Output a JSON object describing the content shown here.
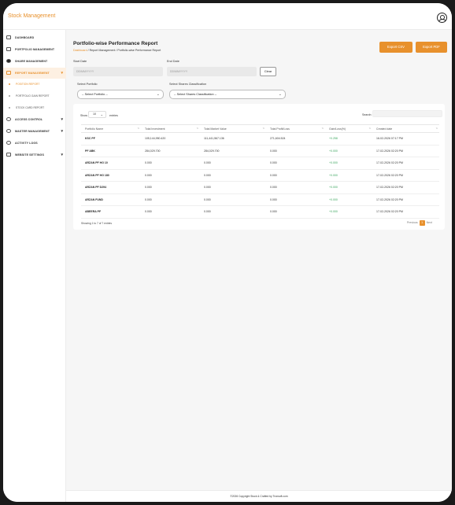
{
  "app": {
    "brand": "Stock Management"
  },
  "sidebar": {
    "items": [
      {
        "label": "DASHBOARD"
      },
      {
        "label": "PORTFOLIO MANAGEMENT"
      },
      {
        "label": "SHARE MANAGEMENT"
      },
      {
        "label": "REPORT MANAGEMENT",
        "expanded": true
      },
      {
        "label": "ACCESS CONTROL"
      },
      {
        "label": "MASTER MANAGEMENT"
      },
      {
        "label": "ACTIVITY LOGS"
      },
      {
        "label": "WEBSITE SETTINGS"
      }
    ],
    "report_sub": [
      {
        "label": "POSITION REPORT",
        "active": true
      },
      {
        "label": "PORTFOLIO GAIN REPORT"
      },
      {
        "label": "STOCK CARD REPORT"
      }
    ]
  },
  "page": {
    "title": "Portfolio-wise Performance Report",
    "breadcrumb_home": "Dashboard",
    "breadcrumb_rest": " / Report Management / Portfolio-wise Performance Report",
    "export_csv": "Export CSV",
    "export_pdf": "Export PDF"
  },
  "filters": {
    "start_label": "Start Date",
    "start_placeholder": "DD/MM/YYYY",
    "end_label": "End Date",
    "end_placeholder": "DD/MM/YYYY",
    "clear": "Clear",
    "portfolio_label": "Select Portfolio",
    "portfolio_value": "-- Select Portfolio --",
    "class_label": "Select Shares Classification",
    "class_value": "-- Select Shares Classification --"
  },
  "table": {
    "show_label": "Show",
    "show_value": "10",
    "entries_label": "entries",
    "search_label": "Search:",
    "columns": [
      "Portfolio Name",
      "Total Investment",
      "Total Market Value",
      "Total Profit/Loss",
      "Gain/Loss(%)",
      "Created date"
    ],
    "rows": [
      [
        "KSC PF",
        "105,144,950.420",
        "111,441,567.136",
        "271,604.524",
        "+0.258",
        "16-02-2026 07:17 PM"
      ],
      [
        "PF ABK",
        "284,029.700",
        "284,029.700",
        "0.000",
        "+0.000",
        "17-02-2026 02:20 PM"
      ],
      [
        "ARZAN PF HG 10",
        "0.000",
        "0.000",
        "0.000",
        "+0.000",
        "17-02-2026 02:20 PM"
      ],
      [
        "ARZAN PF HG 180",
        "0.000",
        "0.000",
        "0.000",
        "+0.000",
        "17-02-2026 02:20 PM"
      ],
      [
        "ARZAN PF D294",
        "0.000",
        "0.000",
        "0.000",
        "+0.000",
        "17-02-2026 02:20 PM"
      ],
      [
        "ARZAN FUND",
        "0.000",
        "0.000",
        "0.000",
        "+0.000",
        "17-02-2026 02:20 PM"
      ],
      [
        "ABEERA PF",
        "0.000",
        "0.000",
        "0.000",
        "+0.000",
        "17-02-2026 02:20 PM"
      ]
    ],
    "showing": "Showing 1 to 7 of 7 entries",
    "previous": "Previous",
    "page": "1",
    "next": "Next"
  },
  "footer": {
    "text": "©2026 Copyright Stock & Crafted by Tronsoft.com"
  },
  "colors": {
    "accent": "#e8912d",
    "gain": "#3aa55d"
  }
}
